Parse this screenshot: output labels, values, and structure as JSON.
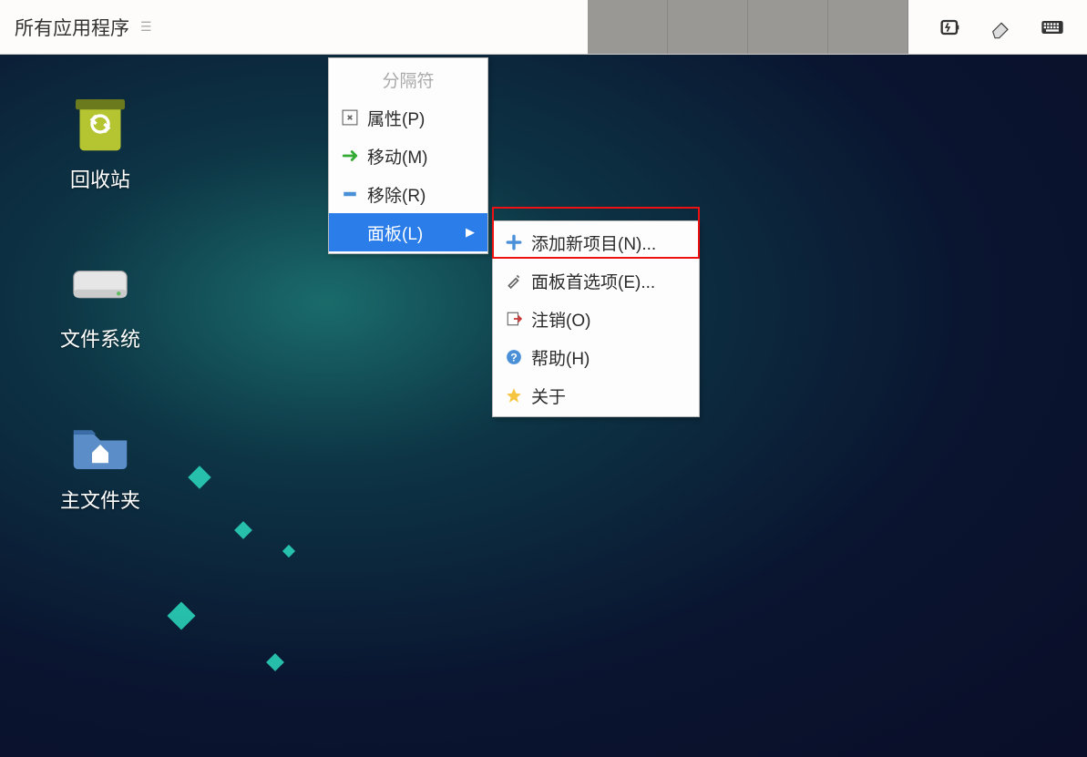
{
  "panel": {
    "app_menu_label": "所有应用程序",
    "tray": {
      "battery": "battery-icon",
      "eraser": "eraser-icon",
      "keyboard": "keyboard-icon"
    }
  },
  "desktop_icons": {
    "recycle": "回收站",
    "filesystem": "文件系统",
    "home": "主文件夹"
  },
  "context_menu_1": {
    "separator": "分隔符",
    "properties": "属性(P)",
    "move": "移动(M)",
    "remove": "移除(R)",
    "panel": "面板(L)"
  },
  "context_menu_2": {
    "add_new_item": "添加新项目(N)...",
    "panel_preferences": "面板首选项(E)...",
    "logout": "注销(O)",
    "help": "帮助(H)",
    "about": "关于"
  }
}
